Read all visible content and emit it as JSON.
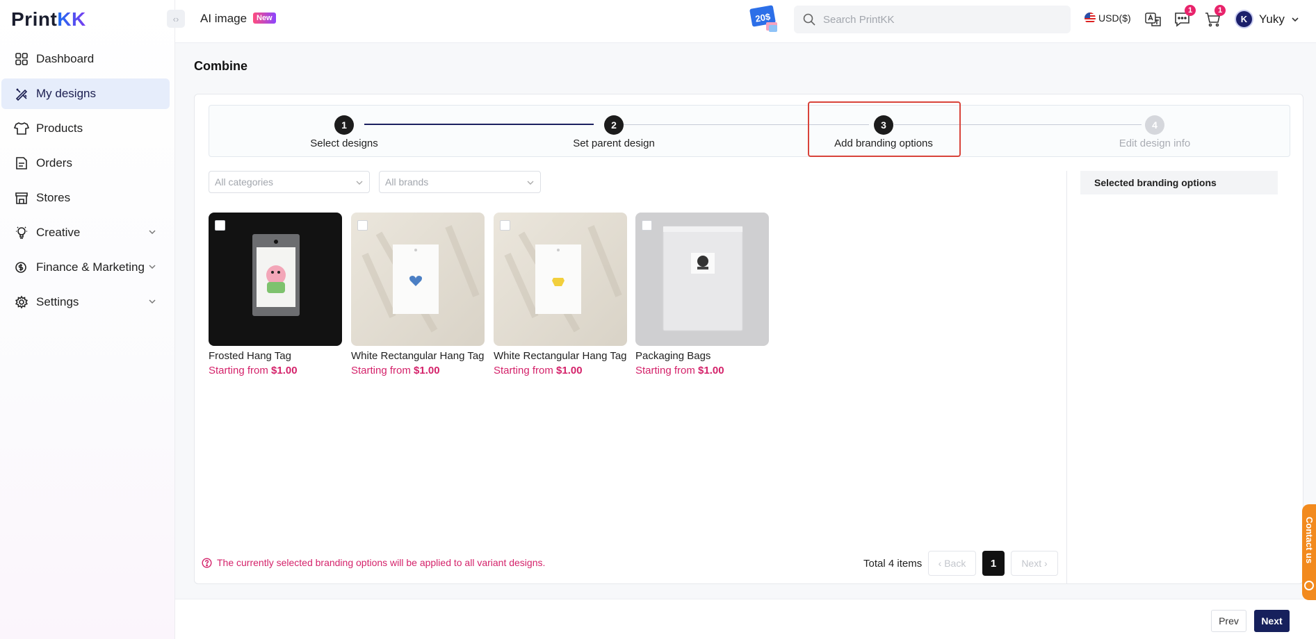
{
  "app": {
    "logo_print": "Print",
    "logo_kk": "KK"
  },
  "sidebar": {
    "items": [
      {
        "label": "Dashboard",
        "icon": "grid-icon"
      },
      {
        "label": "My designs",
        "icon": "design-tools-icon",
        "active": true
      },
      {
        "label": "Products",
        "icon": "tshirt-icon"
      },
      {
        "label": "Orders",
        "icon": "document-icon"
      },
      {
        "label": "Stores",
        "icon": "store-icon"
      },
      {
        "label": "Creative",
        "icon": "lightbulb-icon",
        "expandable": true
      },
      {
        "label": "Finance & Marketing",
        "icon": "dollar-icon",
        "expandable": true
      },
      {
        "label": "Settings",
        "icon": "gear-icon",
        "expandable": true
      }
    ]
  },
  "header": {
    "ai_image": "AI image",
    "new_badge": "New",
    "promo_text": "20$",
    "search_placeholder": "Search PrintKK",
    "currency": "USD($)",
    "messages_count": "1",
    "cart_count": "1",
    "user_initials": "K",
    "user_name": "Yuky"
  },
  "page": {
    "title": "Combine"
  },
  "steps": [
    {
      "number": "1",
      "label": "Select designs",
      "state": "done"
    },
    {
      "number": "2",
      "label": "Set parent design",
      "state": "done"
    },
    {
      "number": "3",
      "label": "Add branding options",
      "state": "current"
    },
    {
      "number": "4",
      "label": "Edit design info",
      "state": "pending"
    }
  ],
  "filters": {
    "category": "All categories",
    "brand": "All brands"
  },
  "products": [
    {
      "name": "Frosted Hang Tag",
      "price_prefix": "Starting from",
      "price": "$1.00"
    },
    {
      "name": "White Rectangular Hang Tag",
      "price_prefix": "Starting from",
      "price": "$1.00"
    },
    {
      "name": "White Rectangular Hang Tag",
      "price_prefix": "Starting from",
      "price": "$1.00"
    },
    {
      "name": "Packaging Bags",
      "price_prefix": "Starting from",
      "price": "$1.00"
    }
  ],
  "side_panel": {
    "title": "Selected branding options"
  },
  "notice": "The currently selected branding options will be applied to all variant designs.",
  "pagination": {
    "total": "Total 4 items",
    "prev": "Back",
    "page": "1",
    "next": "Next"
  },
  "footer": {
    "prev": "Prev",
    "next": "Next"
  },
  "contact": "Contact us",
  "colors": {
    "accent_navy": "#16205c",
    "price_pink": "#d4226a",
    "highlight_red": "#d8433a",
    "contact_orange": "#f28a1e"
  }
}
